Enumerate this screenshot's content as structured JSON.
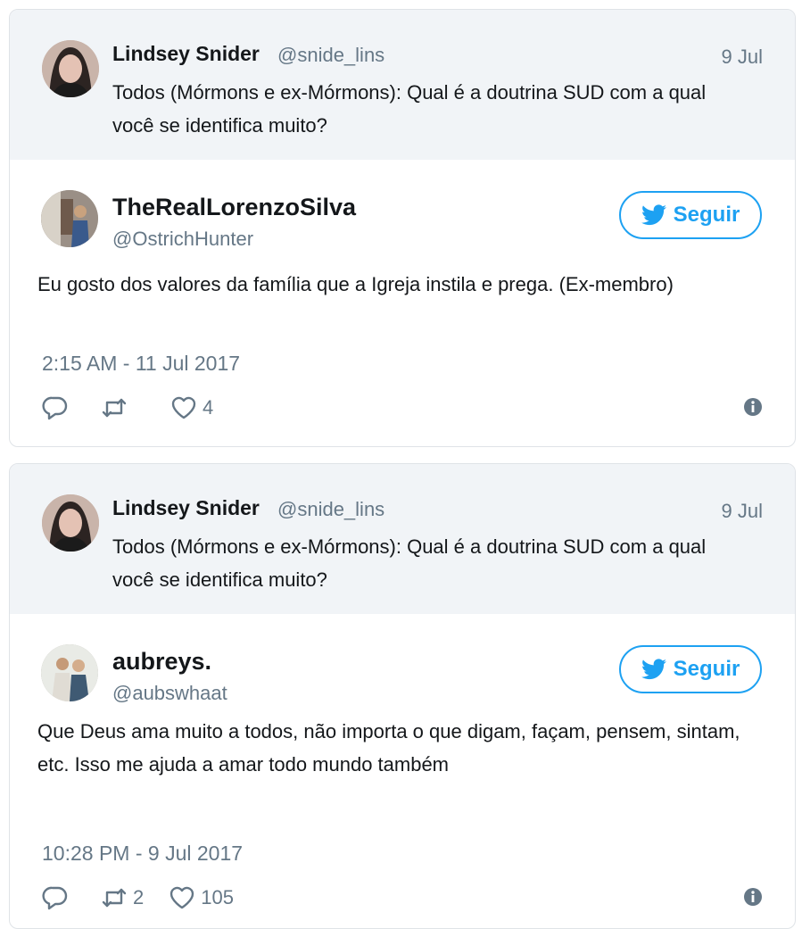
{
  "cards": [
    {
      "quoted": {
        "name": "Lindsey Snider",
        "handle": "@snide_lins",
        "date": "9 Jul",
        "text": "Todos (Mórmons e ex-Mórmons): Qual é a doutrina SUD com a qual você se identifica muito?"
      },
      "reply": {
        "name": "TheRealLorenzoSilva",
        "handle": "@OstrichHunter",
        "follow_label": "Seguir",
        "text": "Eu gosto dos valores da família que a Igreja instila e prega. (Ex-membro)",
        "timestamp": "2:15 AM - 11 Jul 2017",
        "retweets": "",
        "likes": "4"
      }
    },
    {
      "quoted": {
        "name": "Lindsey Snider",
        "handle": "@snide_lins",
        "date": "9 Jul",
        "text": "Todos (Mórmons e ex-Mórmons): Qual é a doutrina SUD com a qual você se identifica muito?"
      },
      "reply": {
        "name": "aubreys.",
        "handle": "@aubswhaat",
        "follow_label": "Seguir",
        "text": "Que Deus ama muito a todos, não importa o que digam, façam, pensem, sintam, etc. Isso me ajuda a amar todo mundo também",
        "timestamp": "10:28 PM - 9 Jul 2017",
        "retweets": "2",
        "likes": "105"
      }
    }
  ],
  "icons": {
    "reply": "reply-icon",
    "retweet": "retweet-icon",
    "like": "heart-icon",
    "info": "info-icon",
    "follow": "twitter-bird-icon"
  },
  "colors": {
    "accent": "#1da1f2",
    "muted": "#657786",
    "quoted_bg": "#f1f4f7"
  }
}
